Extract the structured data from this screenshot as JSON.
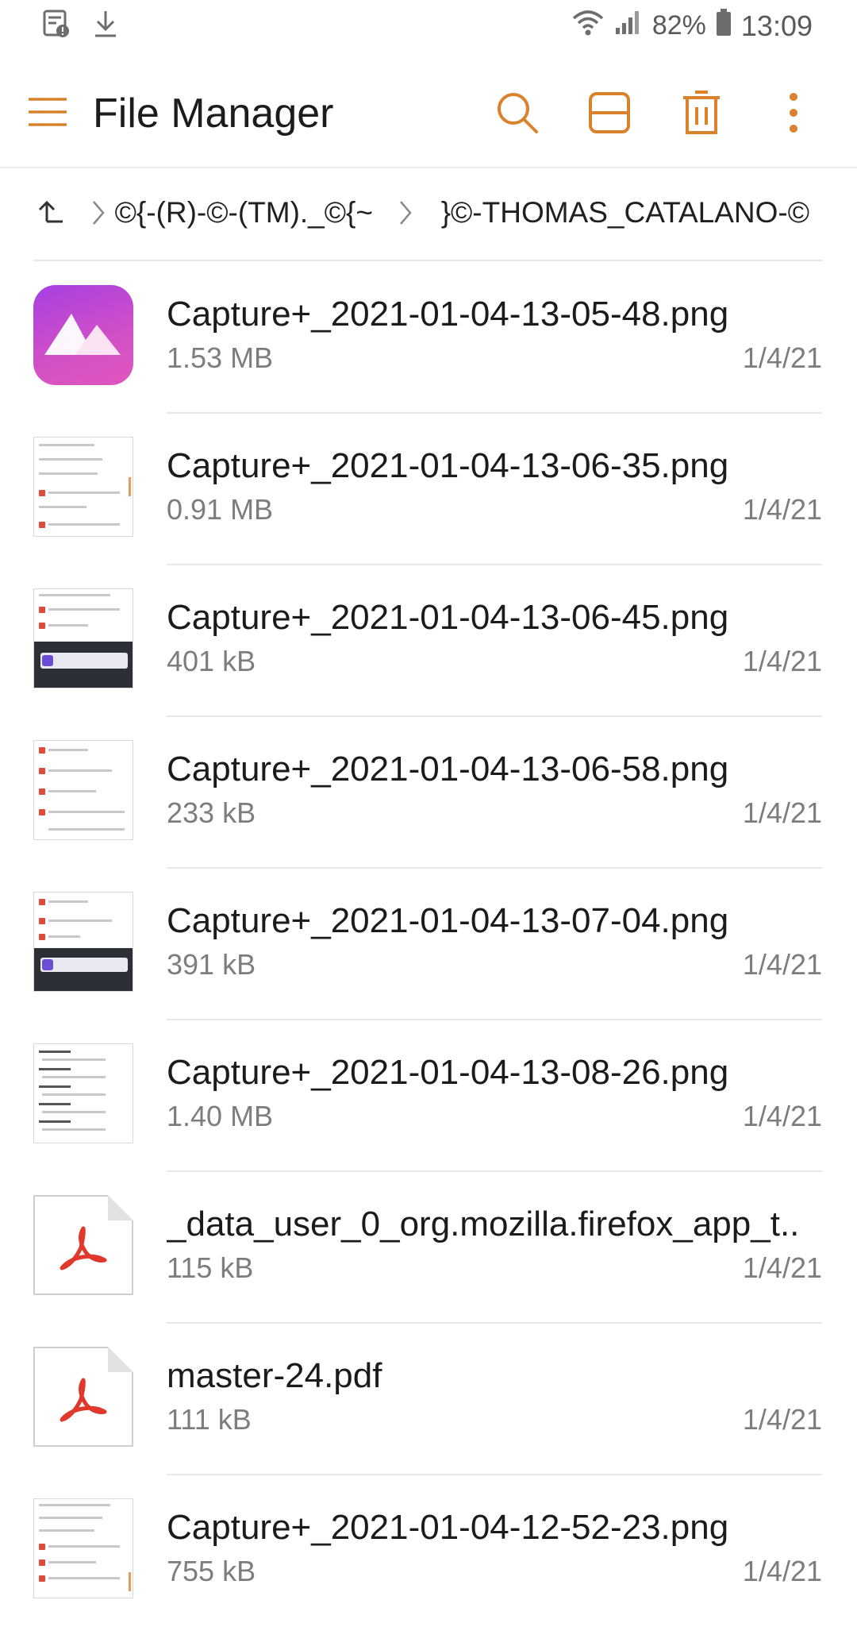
{
  "status_bar": {
    "battery": "82%",
    "time": "13:09",
    "icons": [
      "sim-alert-icon",
      "download-icon",
      "wifi-icon",
      "signal-icon",
      "battery-icon"
    ]
  },
  "app_bar": {
    "title": "File Manager",
    "icons": [
      "menu-icon",
      "search-icon",
      "view-layout-icon",
      "delete-icon",
      "more-icon"
    ],
    "accent_color": "#d9822b"
  },
  "breadcrumb": {
    "up_icon": "up-arrow-icon",
    "items": [
      "©{-(R)-©-(TM)._©{~",
      "}©-THOMAS_CATALANO-©"
    ]
  },
  "files": [
    {
      "name": "Capture+_2021-01-04-13-05-48.png",
      "size": "1.53 MB",
      "date": "1/4/21",
      "thumb": "gallery"
    },
    {
      "name": "Capture+_2021-01-04-13-06-35.png",
      "size": "0.91 MB",
      "date": "1/4/21",
      "thumb": "shot-light"
    },
    {
      "name": "Capture+_2021-01-04-13-06-45.png",
      "size": "401 kB",
      "date": "1/4/21",
      "thumb": "shot-dark"
    },
    {
      "name": "Capture+_2021-01-04-13-06-58.png",
      "size": "233 kB",
      "date": "1/4/21",
      "thumb": "shot-light"
    },
    {
      "name": "Capture+_2021-01-04-13-07-04.png",
      "size": "391 kB",
      "date": "1/4/21",
      "thumb": "shot-dark"
    },
    {
      "name": "Capture+_2021-01-04-13-08-26.png",
      "size": "1.40 MB",
      "date": "1/4/21",
      "thumb": "shot-list"
    },
    {
      "name": "_data_user_0_org.mozilla.firefox_app_t..",
      "size": "115 kB",
      "date": "1/4/21",
      "thumb": "pdf"
    },
    {
      "name": "master-24.pdf",
      "size": "111 kB",
      "date": "1/4/21",
      "thumb": "pdf"
    },
    {
      "name": "Capture+_2021-01-04-12-52-23.png",
      "size": "755 kB",
      "date": "1/4/21",
      "thumb": "shot-light"
    }
  ]
}
